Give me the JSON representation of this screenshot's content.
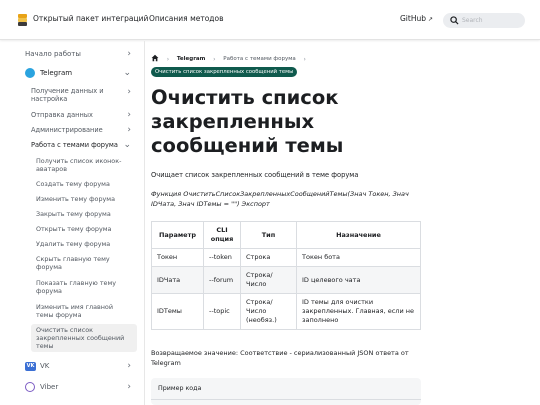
{
  "navbar": {
    "brand": "Открытый пакет интеграций",
    "methods_link": "Описания методов",
    "github_label": "GitHub",
    "search_placeholder": "Search"
  },
  "sidebar": {
    "start": "Начало работы",
    "telegram": "Telegram",
    "get_data": "Получение данных и настройка",
    "send_data": "Отправка данных",
    "admin": "Администрирование",
    "forum_topics": "Работа с темами форума",
    "sub": [
      "Получить список иконок-аватаров",
      "Создать тему форума",
      "Изменить тему форума",
      "Закрыть тему форума",
      "Открыть тему форума",
      "Удалить тему форума",
      "Скрыть главную тему форума",
      "Показать главную тему форума",
      "Изменить имя главной темы форума",
      "Очистить список закрепленных сообщений темы"
    ],
    "vk": "VK",
    "vk_icon_text": "VK",
    "viber": "Viber"
  },
  "breadcrumbs": {
    "telegram": "Telegram",
    "forum_topics": "Работа с темами форума",
    "current": "Очистить список закрепленных сообщений темы"
  },
  "page": {
    "title": "Очистить список закрепленных сообщений темы",
    "description": "Очищает список закрепленных сообщений в теме форума",
    "signature": "Функция ОчиститьСписокЗакрепленныхСообщенийТемы(Знач Токен, Знач IDЧата, Знач IDТемы = \"\") Экспорт",
    "returns": "Возвращаемое значение: Соответствие - сериализованный JSON ответа от Telegram",
    "code_example": "Пример кода"
  },
  "params_table": {
    "headers": [
      "Параметр",
      "CLI опция",
      "Тип",
      "Назначение"
    ],
    "rows": [
      [
        "Токен",
        "--token",
        "Строка",
        "Токен бота"
      ],
      [
        "IDЧата",
        "--forum",
        "Строка/Число",
        "ID целевого чата"
      ],
      [
        "IDТемы",
        "--topic",
        "Строка/Число (необяз.)",
        "ID темы для очистки закрепленных. Главная, если не заполнено"
      ]
    ]
  },
  "colors": {
    "accent_pill": "#0f5a4d",
    "telegram": "#2aa3df",
    "vk": "#3b6fd4",
    "viber": "#7c5cc4"
  }
}
